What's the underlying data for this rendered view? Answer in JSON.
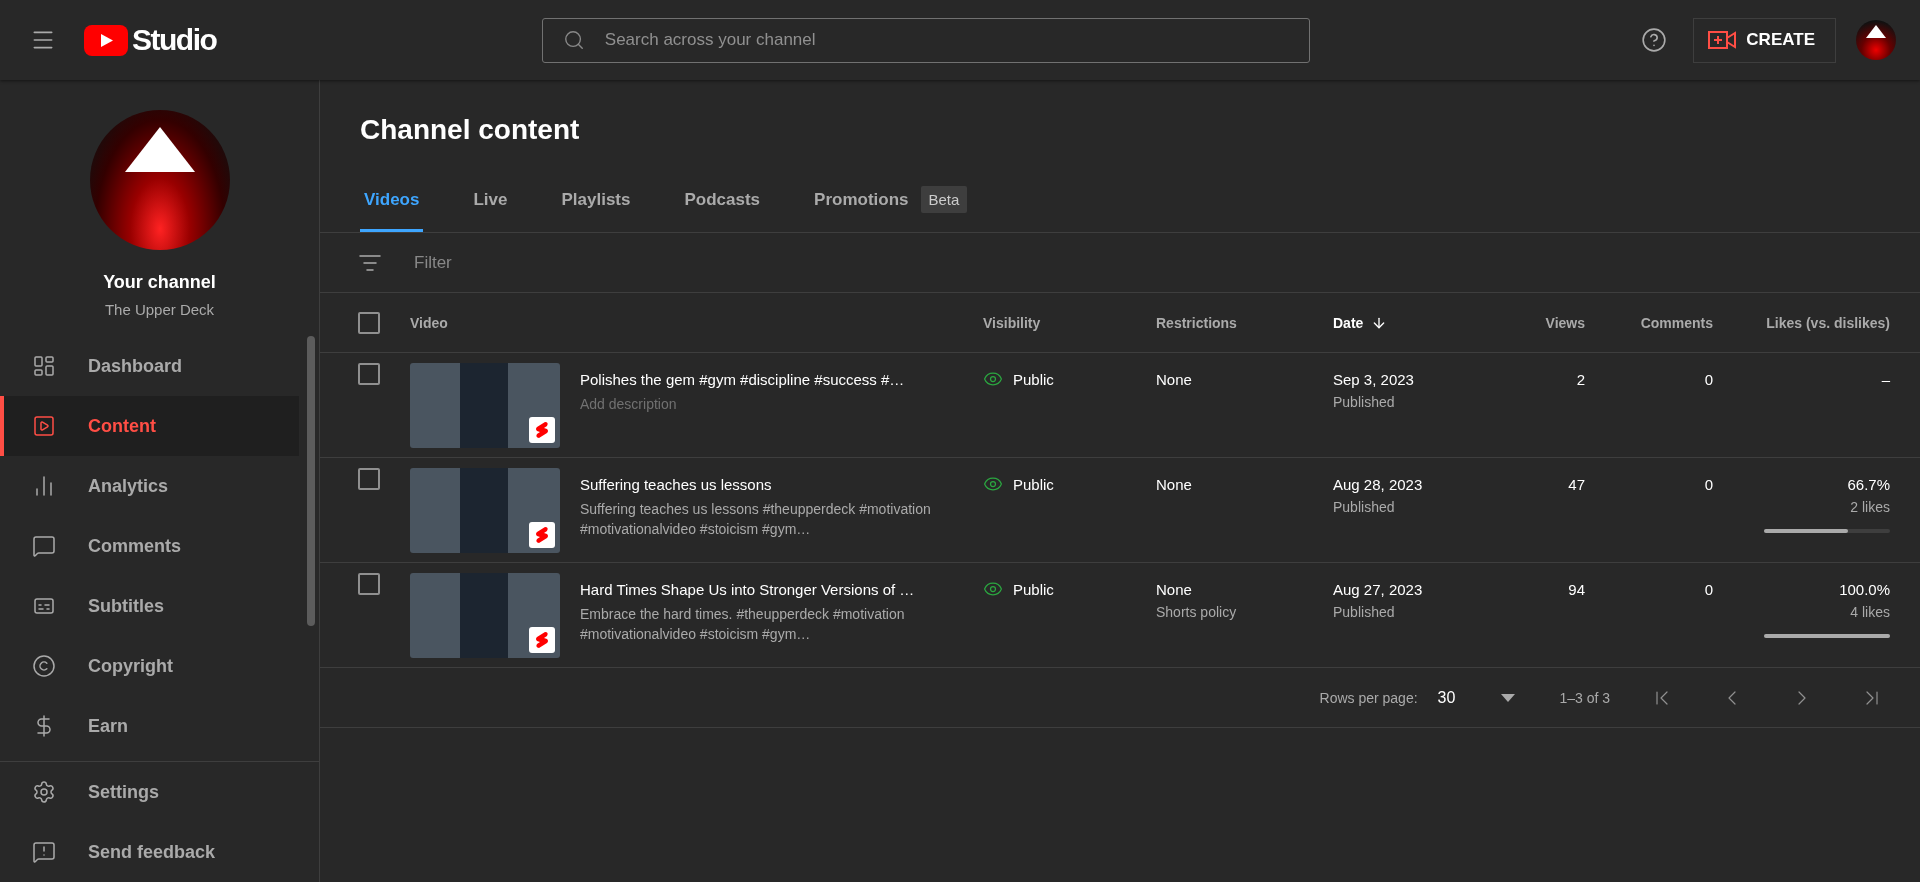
{
  "header": {
    "logo_text": "Studio",
    "search": {
      "placeholder": "Search across your channel"
    },
    "create_button": "CREATE"
  },
  "sidebar": {
    "channel_title": "Your channel",
    "channel_name": "The Upper Deck",
    "items": [
      {
        "label": "Dashboard",
        "kind": "dashboard",
        "selected": false
      },
      {
        "label": "Content",
        "kind": "content",
        "selected": true
      },
      {
        "label": "Analytics",
        "kind": "analytics",
        "selected": false
      },
      {
        "label": "Comments",
        "kind": "comments",
        "selected": false
      },
      {
        "label": "Subtitles",
        "kind": "subtitles",
        "selected": false
      },
      {
        "label": "Copyright",
        "kind": "copyright",
        "selected": false
      },
      {
        "label": "Earn",
        "kind": "earn",
        "selected": false
      }
    ],
    "footer_items": [
      {
        "label": "Settings",
        "kind": "settings"
      },
      {
        "label": "Send feedback",
        "kind": "feedback"
      }
    ]
  },
  "page_title": "Channel content",
  "tabs": [
    {
      "label": "Videos",
      "selected": true
    },
    {
      "label": "Live",
      "selected": false
    },
    {
      "label": "Playlists",
      "selected": false
    },
    {
      "label": "Podcasts",
      "selected": false
    },
    {
      "label": "Promotions",
      "selected": false,
      "badge": "Beta"
    }
  ],
  "filter": {
    "placeholder": "Filter"
  },
  "table": {
    "select_all_checked": false,
    "columns": [
      {
        "label": "Video",
        "sorted": false
      },
      {
        "label": "Visibility",
        "sorted": false
      },
      {
        "label": "Restrictions",
        "sorted": false
      },
      {
        "label": "Date",
        "sorted": true
      },
      {
        "label": "Views",
        "sorted": false
      },
      {
        "label": "Comments",
        "sorted": false
      },
      {
        "label": "Likes (vs. dislikes)",
        "sorted": false
      }
    ],
    "rows": [
      {
        "checked": false,
        "title": "Polishes the gem #gym #discipline #success #…",
        "description": "Add description",
        "description_empty": true,
        "visibility": "Public",
        "restrictions": "None",
        "date": "Sep 3, 2023",
        "status": "Published",
        "views": "2",
        "comments": "0",
        "likes": "–"
      },
      {
        "checked": false,
        "title": "Suffering teaches us lessons",
        "description": "Suffering teaches us lessons #theupperdeck #motivation #motivationalvideo #stoicism #gym…",
        "description_empty": false,
        "visibility": "Public",
        "restrictions": "None",
        "date": "Aug 28, 2023",
        "status": "Published",
        "views": "47",
        "comments": "0",
        "likes": "66.7%",
        "likes_count": "2 likes",
        "level": 0.67
      },
      {
        "checked": false,
        "title": "Hard Times Shape Us into Stronger Versions of …",
        "description": "Embrace the hard times. #theupperdeck #motivation #motivationalvideo #stoicism #gym…",
        "description_empty": false,
        "visibility": "Public",
        "restrictions": "None",
        "restriction_note": "Shorts policy",
        "date": "Aug 27, 2023",
        "status": "Published",
        "views": "94",
        "comments": "0",
        "likes": "100.0%",
        "likes_count": "4 likes",
        "level": 1.0
      }
    ]
  },
  "pagination": {
    "rows_per_page_label": "Rows per page:",
    "rows_per_page": "30",
    "range": "1–3 of 3"
  }
}
